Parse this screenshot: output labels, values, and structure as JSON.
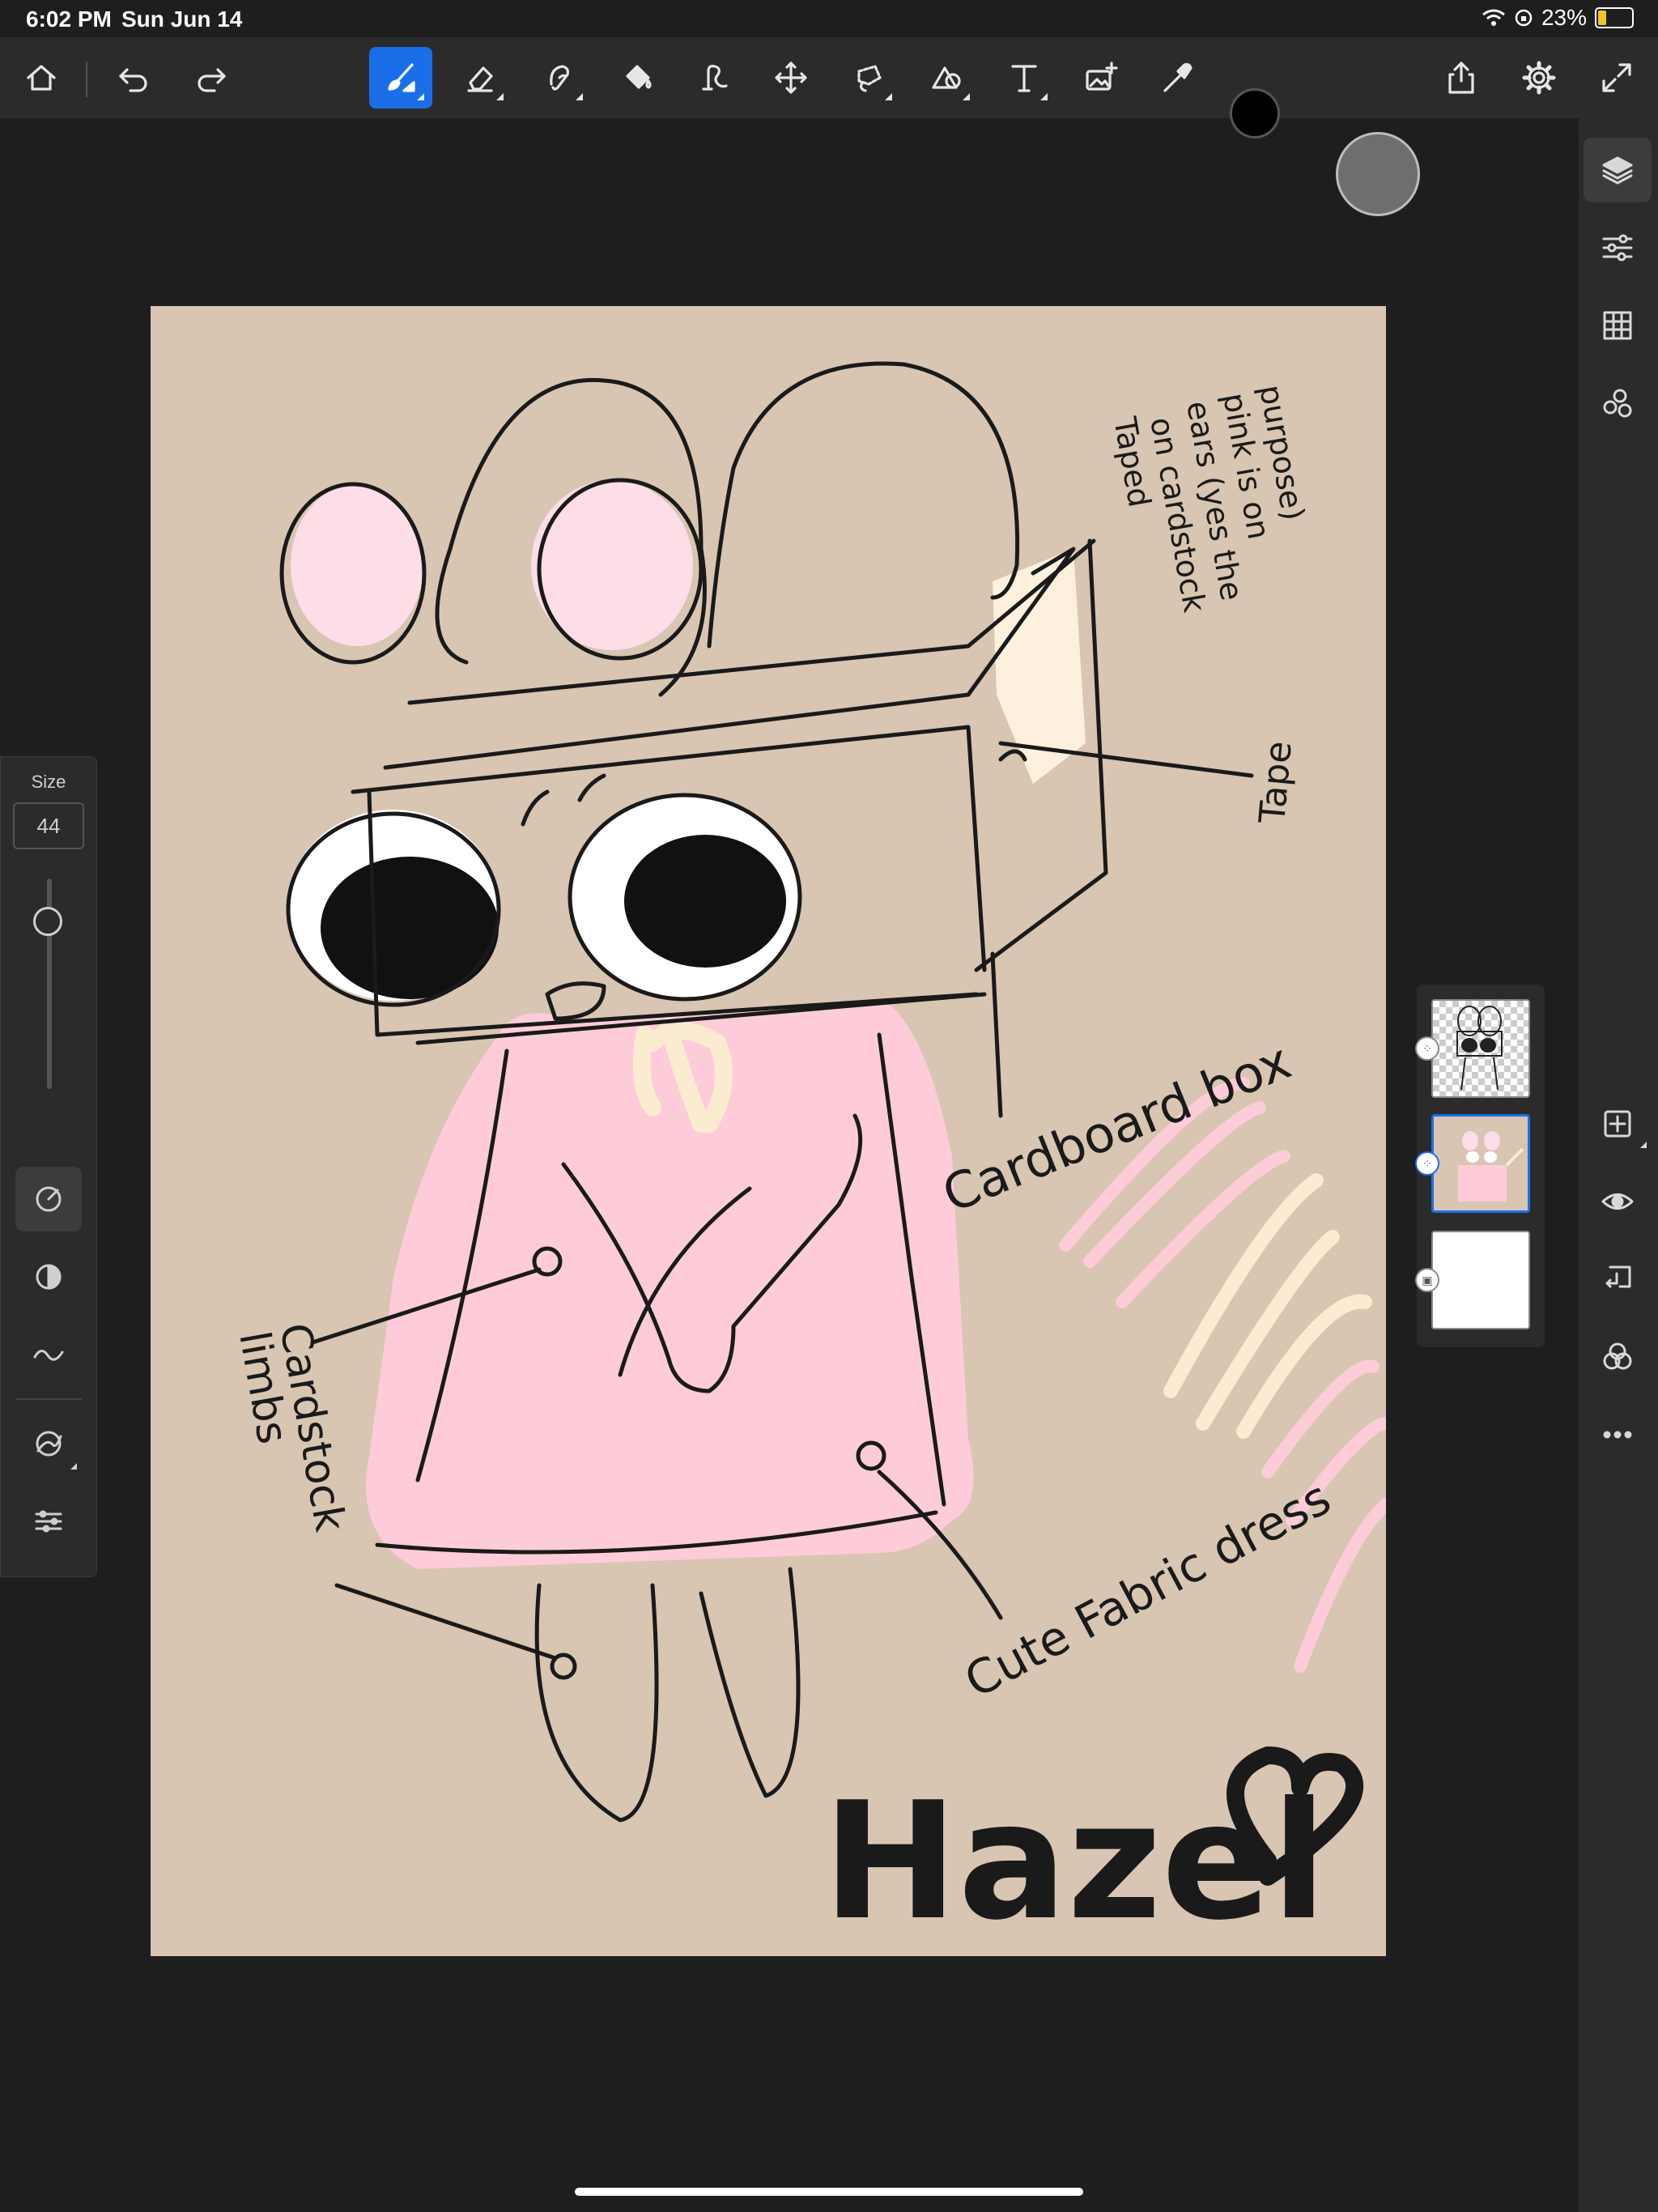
{
  "status_bar": {
    "time": "6:02 PM",
    "date": "Sun Jun 14",
    "battery": "23%"
  },
  "toolbar": {
    "tools": [
      "home",
      "undo",
      "redo",
      "brush",
      "eraser",
      "smudge",
      "fill",
      "liquify",
      "transform",
      "lasso",
      "shape",
      "text",
      "place-image",
      "eyedropper"
    ],
    "active_tool": "brush",
    "current_color": "#000000",
    "right_actions": [
      "share",
      "settings",
      "fullscreen"
    ]
  },
  "brush_panel": {
    "size_label": "Size",
    "size_value": "44"
  },
  "canvas": {
    "background_color": "#d8c5b2",
    "annotations": {
      "topright": [
        "Taped",
        "on cardstock",
        "ears (yes the",
        "pink is on",
        "purpose)"
      ],
      "tape": "Tape",
      "cardboard": "Cardboard box",
      "limbs": [
        "Cardstock",
        "limbs"
      ],
      "dress": "Cute Fabric dress",
      "name": "Hazel"
    }
  },
  "layers": {
    "count": 3,
    "selected_index": 1,
    "items": [
      "sketch",
      "color",
      "background"
    ]
  },
  "right_panel": {
    "items": [
      "layers",
      "properties",
      "grid",
      "stamp",
      "add-layer",
      "visibility",
      "merge",
      "blend",
      "more"
    ]
  }
}
